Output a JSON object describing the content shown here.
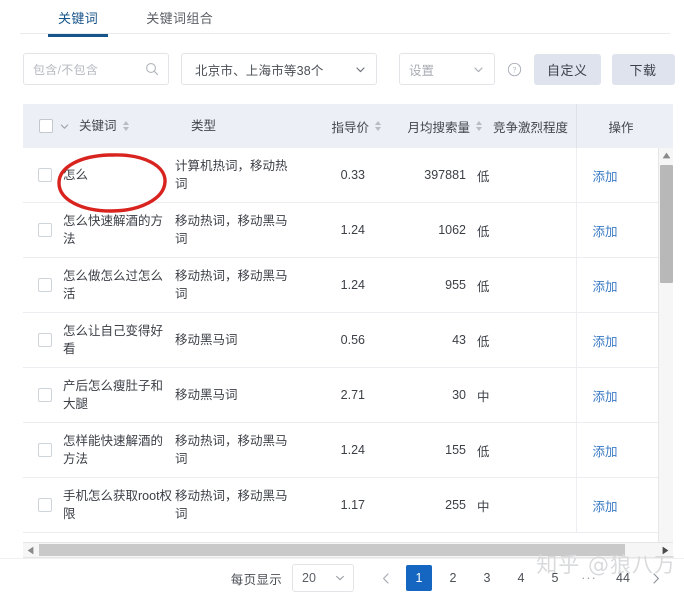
{
  "tabs": [
    {
      "label": "关键词",
      "active": true
    },
    {
      "label": "关键词组合",
      "active": false
    }
  ],
  "toolbar": {
    "search_placeholder": "包含/不包含",
    "search_value": "",
    "search_icon": "search-icon",
    "region_value": "北京市、上海市等38个",
    "region_caret": "chevron-down-icon",
    "settings_value": "设置",
    "settings_caret": "chevron-down-icon",
    "help_icon": "question-circle-icon",
    "custom_label": "自定义",
    "download_label": "下载"
  },
  "table": {
    "headers": {
      "select_all": "",
      "keyword": "关键词",
      "type": "类型",
      "price": "指导价",
      "volume": "月均搜索量",
      "competition": "竞争激烈程度",
      "action": "操作"
    },
    "action_label": "添加",
    "rows": [
      {
        "keyword": "怎么",
        "type": "计算机热词，移动热词",
        "price": "0.33",
        "volume": "397881",
        "competition": "低",
        "action": "添加"
      },
      {
        "keyword": "怎么快速解酒的方法",
        "type": "移动热词，移动黑马词",
        "price": "1.24",
        "volume": "1062",
        "competition": "低",
        "action": "添加"
      },
      {
        "keyword": "怎么做怎么过怎么活",
        "type": "移动热词，移动黑马词",
        "price": "1.24",
        "volume": "955",
        "competition": "低",
        "action": "添加"
      },
      {
        "keyword": "怎么让自己变得好看",
        "type": "移动黑马词",
        "price": "0.56",
        "volume": "43",
        "competition": "低",
        "action": "添加"
      },
      {
        "keyword": "产后怎么瘦肚子和大腿",
        "type": "移动黑马词",
        "price": "2.71",
        "volume": "30",
        "competition": "中",
        "action": "添加"
      },
      {
        "keyword": "怎样能快速解酒的方法",
        "type": "移动热词，移动黑马词",
        "price": "1.24",
        "volume": "155",
        "competition": "低",
        "action": "添加"
      },
      {
        "keyword": "手机怎么获取root权限",
        "type": "移动热词，移动黑马词",
        "price": "1.17",
        "volume": "255",
        "competition": "中",
        "action": "添加"
      }
    ]
  },
  "pagination": {
    "page_size_label": "每页显示",
    "page_size_value": "20",
    "prev_icon": "chevron-left-icon",
    "next_icon": "chevron-right-icon",
    "pages": [
      "1",
      "2",
      "3",
      "4",
      "5"
    ],
    "ellipsis": "···",
    "last_page": "44",
    "current_page": "1"
  },
  "annotation": {
    "shape": "red-ellipse",
    "target": "怎么",
    "color": "#d8231f"
  },
  "watermark": {
    "text": "知乎 @狼八万"
  },
  "colors": {
    "accent": "#17548a",
    "link": "#3a7ac4",
    "active_page": "#1466c0",
    "button_bg": "#dfe3ee",
    "header_bg": "#eceff5"
  }
}
